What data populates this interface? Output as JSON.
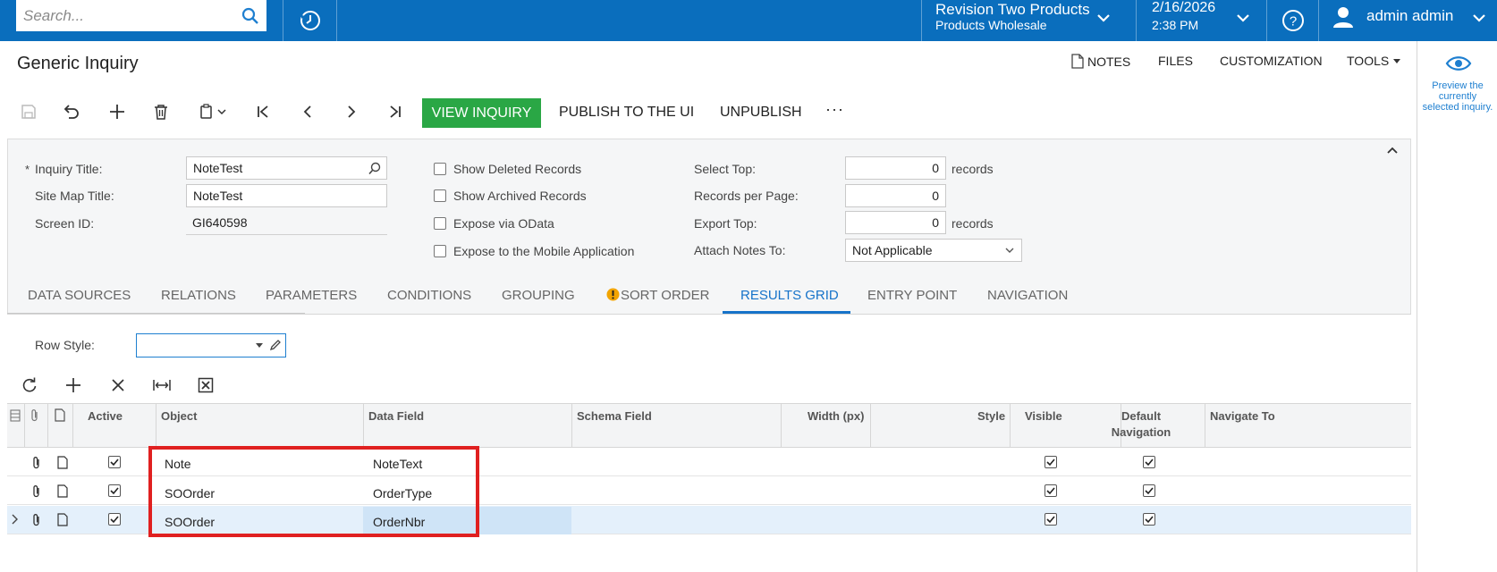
{
  "topbar": {
    "search_placeholder": "Search...",
    "company_name": "Revision Two Products",
    "branch": "Products Wholesale",
    "date": "2/16/2026",
    "time": "2:38 PM",
    "user": "admin admin",
    "bg_color": "#0a6ebd"
  },
  "page": {
    "title": "Generic Inquiry",
    "header_links": [
      "NOTES",
      "FILES",
      "CUSTOMIZATION",
      "TOOLS"
    ]
  },
  "toolbar": {
    "view_inquiry": "VIEW INQUIRY",
    "publish": "PUBLISH TO THE UI",
    "unpublish": "UNPUBLISH",
    "more": "···",
    "accent": "#2aa745"
  },
  "right_panel": {
    "preview_text": "Preview the currently selected inquiry."
  },
  "form": {
    "inquiry_title_label": "Inquiry Title:",
    "inquiry_title_value": "NoteTest",
    "required_mark": "*",
    "site_map_title_label": "Site Map Title:",
    "site_map_title_value": "NoteTest",
    "screen_id_label": "Screen ID:",
    "screen_id_value": "GI640598",
    "show_deleted": "Show Deleted Records",
    "show_archived": "Show Archived Records",
    "expose_odata": "Expose via OData",
    "expose_mobile": "Expose to the Mobile Application",
    "select_top_label": "Select Top:",
    "select_top_value": "0",
    "select_top_unit": "records",
    "records_per_page_label": "Records per Page:",
    "records_per_page_value": "0",
    "export_top_label": "Export Top:",
    "export_top_value": "0",
    "export_top_unit": "records",
    "attach_notes_label": "Attach Notes To:",
    "attach_notes_value": "Not Applicable"
  },
  "tabs": [
    {
      "label": "DATA SOURCES"
    },
    {
      "label": "RELATIONS"
    },
    {
      "label": "PARAMETERS"
    },
    {
      "label": "CONDITIONS"
    },
    {
      "label": "GROUPING"
    },
    {
      "label": "SORT ORDER"
    },
    {
      "label": "RESULTS GRID"
    },
    {
      "label": "ENTRY POINT"
    },
    {
      "label": "NAVIGATION"
    }
  ],
  "results_grid": {
    "row_style_label": "Row Style:",
    "columns": {
      "active": "Active",
      "object": "Object",
      "data_field": "Data Field",
      "schema_field": "Schema Field",
      "width": "Width (px)",
      "style": "Style",
      "visible": "Visible",
      "default_nav": "Default Navigation",
      "navigate_to": "Navigate To"
    },
    "rows": [
      {
        "object": "Note",
        "data_field": "NoteText",
        "active": true,
        "visible": true,
        "default_nav": true
      },
      {
        "object": "SOOrder",
        "data_field": "OrderType",
        "active": true,
        "visible": true,
        "default_nav": true
      },
      {
        "object": "SOOrder",
        "data_field": "OrderNbr",
        "active": true,
        "visible": true,
        "default_nav": true
      }
    ]
  }
}
